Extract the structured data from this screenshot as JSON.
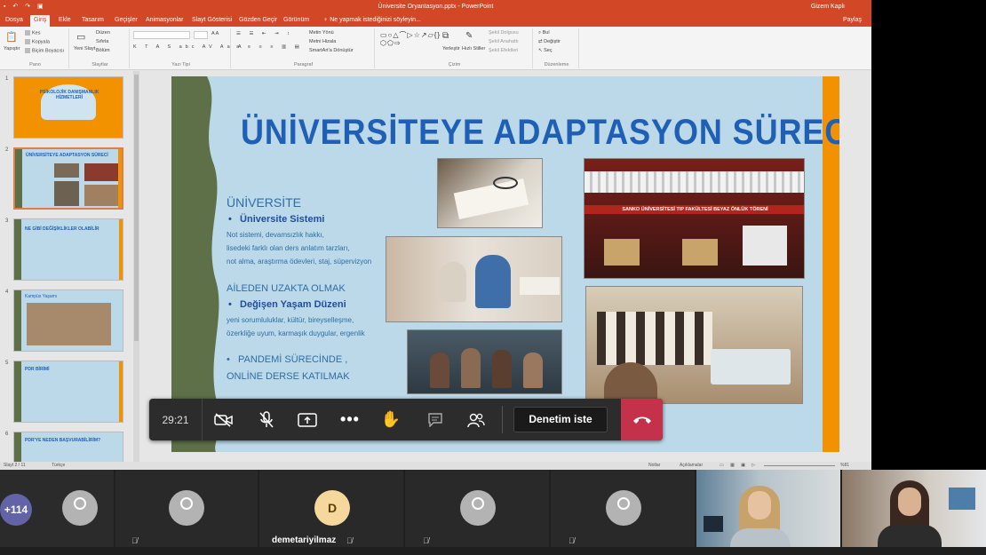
{
  "app": {
    "window_title": "Üniversite Oryantasyon.pptx - PowerPoint",
    "user": "Gizem Kaplı",
    "share": "Paylaş"
  },
  "ribbon": {
    "tabs": [
      "Dosya",
      "Giriş",
      "Ekle",
      "Tasarım",
      "Geçişler",
      "Animasyonlar",
      "Slayt Gösterisi",
      "Gözden Geçir",
      "Görünüm"
    ],
    "active_tab": "Giriş",
    "tell_me": "Ne yapmak istediğinizi söyleyin...",
    "groups": {
      "clipboard": {
        "label": "Pano",
        "paste": "Yapıştır",
        "cut": "Kes",
        "copy": "Kopyala",
        "format": "Biçim Boyacısı"
      },
      "slides": {
        "label": "Slaytlar",
        "new": "Yeni Slayt",
        "layout": "Düzen",
        "reset": "Sıfırla",
        "section": "Bölüm"
      },
      "font": {
        "label": "Yazı Tipi"
      },
      "paragraph": {
        "label": "Paragraf",
        "direction": "Metin Yönü",
        "align": "Metni Hizala",
        "smartart": "SmartArt'a Dönüştür"
      },
      "drawing": {
        "label": "Çizim",
        "arrange": "Yerleştir",
        "styles": "Hızlı Stiller",
        "fill": "Şekil Dolgusu",
        "outline": "Şekil Anahattı",
        "effects": "Şekil Efektleri"
      },
      "editing": {
        "label": "Düzenleme",
        "find": "Bul",
        "replace": "Değiştir",
        "select": "Seç"
      }
    }
  },
  "thumbnails": {
    "numbers": [
      "1",
      "2",
      "3",
      "4",
      "5",
      "6"
    ],
    "texts": [
      "PSİKOLOJİK DANIŞMANLIK HİZMETLERİ",
      "ÜNİVERSİTEYE ADAPTASYON SÜRECİ",
      "NE GİBİ DEĞİŞİKLİKLER OLABİLİR",
      "Kampüs Yaşamı",
      "PDR BİRİMİ",
      "PDR'YE NEDEN BAŞVURABİLİRİM?"
    ]
  },
  "slide": {
    "title": "ÜNİVERSİTEYE ADAPTASYON SÜRECİ",
    "section1_heading": "ÜNİVERSİTE",
    "section1_bullet": "Üniversite Sistemi",
    "section1_line1": "Not sistemi, devamsızlık hakkı,",
    "section1_line2": "lisedeki farklı olan ders anlatım tarzları,",
    "section1_line3": "not alma, araştırma ödevleri, staj, süpervizyon",
    "section2_heading": "AİLEDEN UZAKTA OLMAK",
    "section2_bullet": "Değişen Yaşam Düzeni",
    "section2_line1": "yeni sorumluluklar, kültür, bireyselleşme,",
    "section2_line2": "özerkliğe uyum, karmaşık duygular, ergenlik",
    "section3_line1": "PANDEMİ SÜRECİNDE ,",
    "section3_line2": "ONLİNE DERSE KATILMAK",
    "banner_text": "SANKO ÜNİVERSİTESİ TIP FAKÜLTESİ BEYAZ ÖNLÜK TÖRENİ"
  },
  "status": {
    "slide_info": "Slayt 2 / 11",
    "language": "Türkçe",
    "notes": "Notlar",
    "comments": "Açıklamalar",
    "zoom": "%81"
  },
  "call": {
    "timer": "29:21",
    "request_control": "Denetim iste",
    "overflow_count": "+114",
    "participant_initial": "D",
    "participant_name": "demetariyilmaz"
  },
  "colors": {
    "office_orange": "#d24726",
    "slide_blue": "#bcd9ea",
    "title_blue": "#1f5fb5",
    "hangup_red": "#c4314b",
    "teams_purple": "#6264a7"
  }
}
